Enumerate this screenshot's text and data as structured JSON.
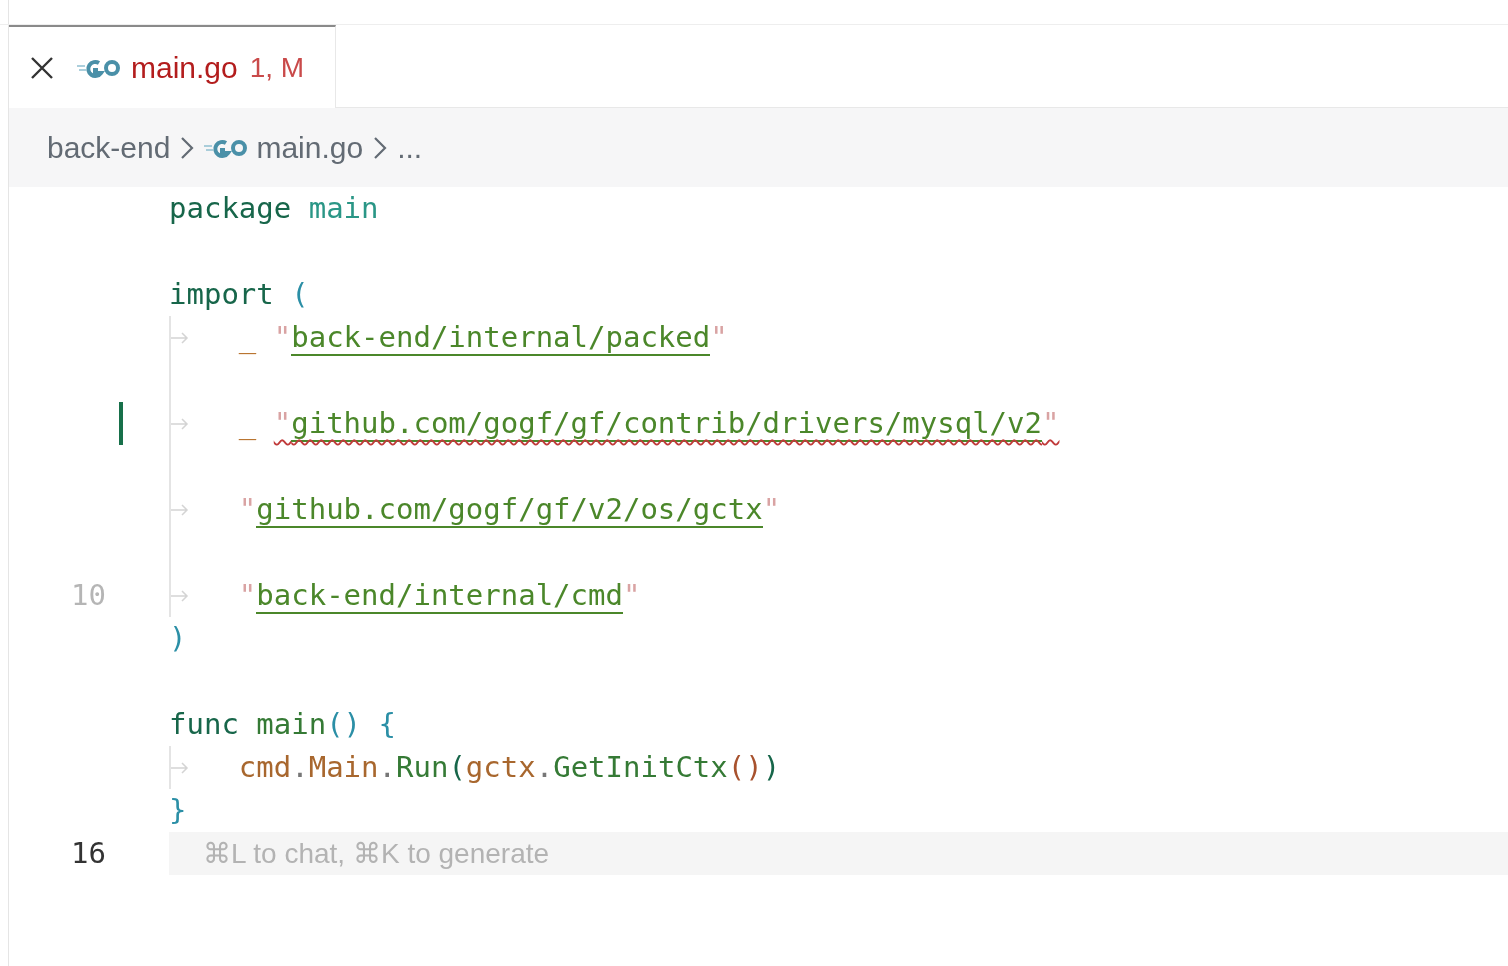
{
  "tabs": [
    {
      "label": "main.go",
      "badge": "1, M",
      "selected": true
    }
  ],
  "breadcrumbs": [
    {
      "kind": "folder",
      "label": "back-end"
    },
    {
      "kind": "go",
      "label": "main.go"
    },
    {
      "kind": "more",
      "label": "..."
    }
  ],
  "lines": [
    {
      "tokens": [
        {
          "kind": "keyword",
          "t": "package "
        },
        {
          "kind": "name",
          "t": "main"
        }
      ]
    },
    {
      "kind": "empty"
    },
    {
      "tokens": [
        {
          "kind": "keyword",
          "t": "import "
        },
        {
          "kind": "paren",
          "t": "("
        }
      ]
    },
    {
      "tokens": [
        {
          "kind": "tab"
        },
        {
          "kind": "blank",
          "t": "_ "
        },
        {
          "kind": "import",
          "open": "\"",
          "path": "back-end/internal/packed",
          "close": "\"",
          "error": false
        }
      ]
    },
    {
      "tokens": [
        {
          "kind": "guide"
        }
      ]
    },
    {
      "modified": true,
      "tokens": [
        {
          "kind": "tab"
        },
        {
          "kind": "blank",
          "t": "_ "
        },
        {
          "kind": "import",
          "open": "\"",
          "path": "github.com/gogf/gf/contrib/drivers/mysql/v2",
          "close": "\"",
          "error": true
        }
      ]
    },
    {
      "tokens": [
        {
          "kind": "guide"
        }
      ]
    },
    {
      "tokens": [
        {
          "kind": "tab"
        },
        {
          "kind": "import",
          "open": "\"",
          "path": "github.com/gogf/gf/v2/os/gctx",
          "close": "\"",
          "error": false
        }
      ]
    },
    {
      "tokens": [
        {
          "kind": "guide"
        }
      ]
    },
    {
      "number": "10",
      "active": false,
      "tokens": [
        {
          "kind": "tab"
        },
        {
          "kind": "import",
          "open": "\"",
          "path": "back-end/internal/cmd",
          "close": "\"",
          "error": false
        }
      ]
    },
    {
      "tokens": [
        {
          "kind": "paren",
          "t": ")"
        }
      ]
    },
    {
      "kind": "empty"
    },
    {
      "tokens": [
        {
          "kind": "keyword",
          "t": "func "
        },
        {
          "kind": "func",
          "t": "main"
        },
        {
          "kind": "paren",
          "t": "() {"
        }
      ]
    },
    {
      "tokens": [
        {
          "kind": "tab"
        },
        {
          "kind": "var",
          "t": "cmd"
        },
        {
          "kind": "dot",
          "t": "."
        },
        {
          "kind": "var",
          "t": "Main"
        },
        {
          "kind": "dot",
          "t": "."
        },
        {
          "kind": "call",
          "t": "Run"
        },
        {
          "kind": "callparen",
          "t": "("
        },
        {
          "kind": "var",
          "t": "gctx"
        },
        {
          "kind": "dot",
          "t": "."
        },
        {
          "kind": "call",
          "t": "GetInitCtx"
        },
        {
          "kind": "innerparen",
          "t": "()"
        },
        {
          "kind": "callparen",
          "t": ")"
        }
      ]
    },
    {
      "tokens": [
        {
          "kind": "paren",
          "t": "}"
        }
      ]
    },
    {
      "number": "16",
      "active": true,
      "hint": "⌘L to chat, ⌘K to generate"
    }
  ]
}
